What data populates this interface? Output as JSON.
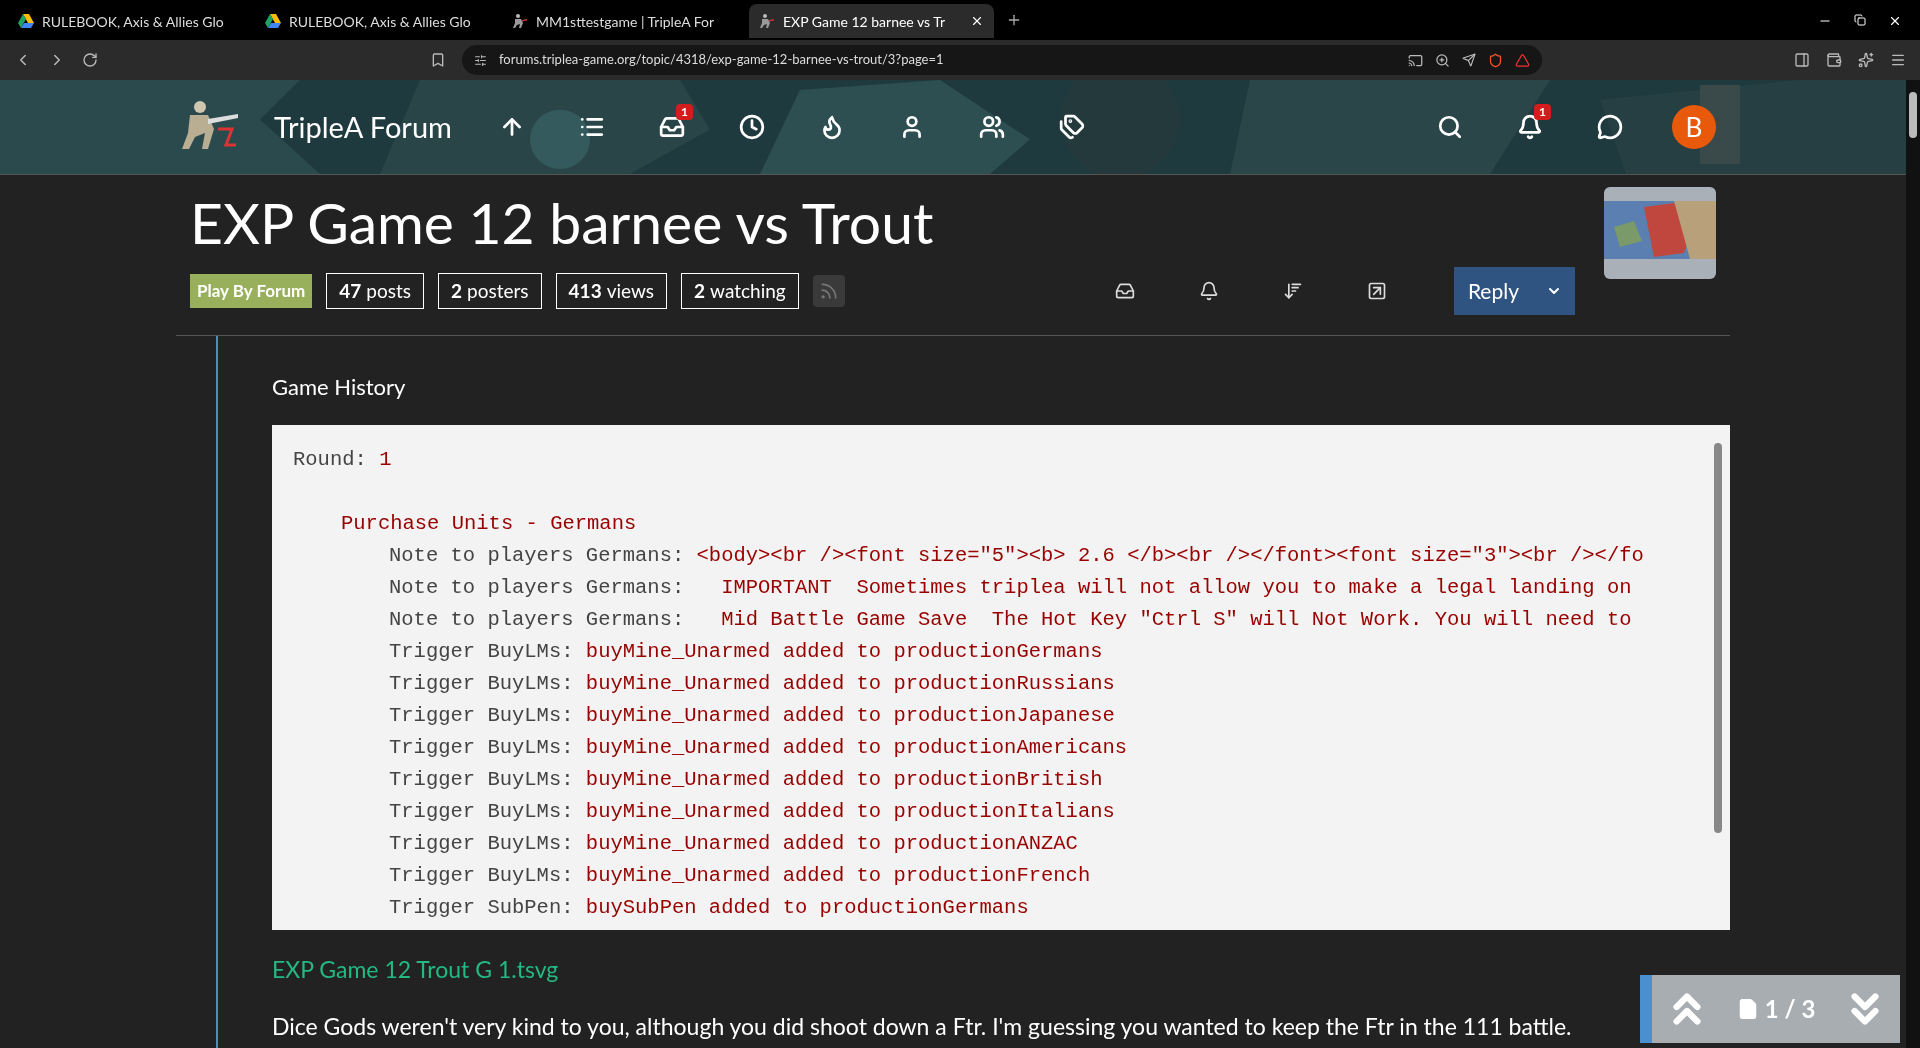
{
  "browser": {
    "tabs": [
      {
        "title": "RULEBOOK, Axis & Allies Glo",
        "kind": "drive",
        "selected": false
      },
      {
        "title": "RULEBOOK, Axis & Allies Glo",
        "kind": "drive",
        "selected": false
      },
      {
        "title": "MM1sttestgame | TripleA For",
        "kind": "triplea",
        "selected": false
      },
      {
        "title": "EXP Game 12 barnee vs Tr",
        "kind": "triplea",
        "selected": true
      }
    ],
    "url": "forums.triplea-game.org/topic/4318/exp-game-12-barnee-vs-trout/3?page=1"
  },
  "header": {
    "brand": "TripleA Forum",
    "nav": [
      {
        "kind": "top"
      },
      {
        "kind": "list"
      },
      {
        "kind": "inbox",
        "badge": "1"
      },
      {
        "kind": "recent"
      },
      {
        "kind": "popular"
      },
      {
        "kind": "user"
      },
      {
        "kind": "groups"
      },
      {
        "kind": "tags"
      }
    ],
    "actions": [
      {
        "kind": "search"
      },
      {
        "kind": "notifications",
        "badge": "1"
      },
      {
        "kind": "chat"
      }
    ],
    "avatar": "B"
  },
  "topic": {
    "title": "EXP Game 12 barnee vs Trout",
    "category": "Play By Forum",
    "stats": [
      {
        "count": "47",
        "label": "posts"
      },
      {
        "count": "2",
        "label": "posters"
      },
      {
        "count": "413",
        "label": "views"
      },
      {
        "count": "2",
        "label": "watching"
      }
    ],
    "tools": [
      {
        "kind": "inbox"
      },
      {
        "kind": "watch"
      },
      {
        "kind": "sort"
      },
      {
        "kind": "share"
      }
    ],
    "reply": "Reply"
  },
  "post": {
    "heading": "Game History",
    "code": [
      {
        "label": "Round: ",
        "value": "1",
        "children": [
          {
            "value": "Purchase Units - Germans",
            "children": [
              {
                "label": "Note to players Germans: ",
                "value": "<body><br /><font size=\"5\"><b> 2.6 </b><br /></font><font size=\"3\"><br /></fo"
              },
              {
                "label": "Note to players Germans: ",
                "value": "  IMPORTANT  Sometimes triplea will not allow you to make a legal landing on"
              },
              {
                "label": "Note to players Germans: ",
                "value": "  Mid Battle Game Save  The Hot Key \"Ctrl S\" will Not Work. You will need to"
              },
              {
                "label": "Trigger BuyLMs: ",
                "value": "buyMine_Unarmed added to productionGermans"
              },
              {
                "label": "Trigger BuyLMs: ",
                "value": "buyMine_Unarmed added to productionRussians"
              },
              {
                "label": "Trigger BuyLMs: ",
                "value": "buyMine_Unarmed added to productionJapanese"
              },
              {
                "label": "Trigger BuyLMs: ",
                "value": "buyMine_Unarmed added to productionAmericans"
              },
              {
                "label": "Trigger BuyLMs: ",
                "value": "buyMine_Unarmed added to productionBritish"
              },
              {
                "label": "Trigger BuyLMs: ",
                "value": "buyMine_Unarmed added to productionItalians"
              },
              {
                "label": "Trigger BuyLMs: ",
                "value": "buyMine_Unarmed added to productionANZAC"
              },
              {
                "label": "Trigger BuyLMs: ",
                "value": "buyMine_Unarmed added to productionFrench"
              },
              {
                "label": "Trigger SubPen: ",
                "value": "buySubPen added to productionGermans"
              }
            ]
          }
        ]
      }
    ],
    "attachment": "EXP Game 12 Trout G 1.tsvg",
    "text": "Dice Gods weren't very kind to you, although you did shoot down a Ftr. I'm guessing you wanted to keep the Ftr in the 111 battle."
  },
  "pager": {
    "page": "1 / 3"
  }
}
